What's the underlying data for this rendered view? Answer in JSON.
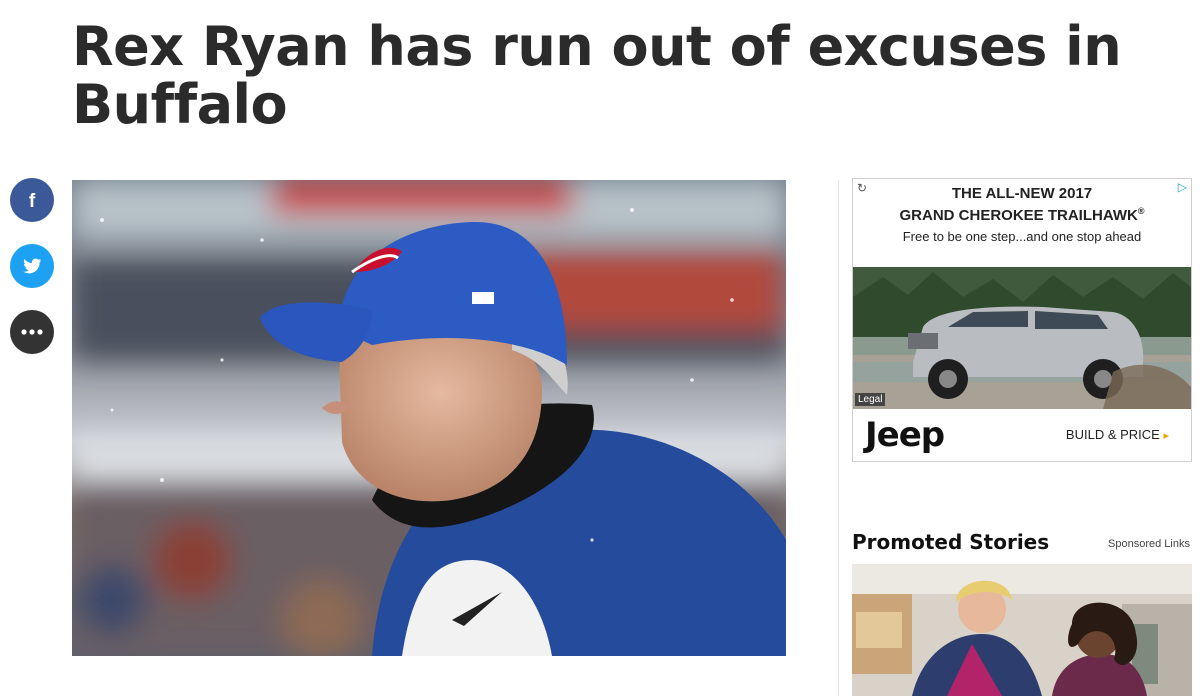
{
  "article": {
    "title": "Rex Ryan has run out of excuses in Buffalo"
  },
  "share": {
    "facebook_icon": "facebook-icon",
    "twitter_icon": "twitter-icon",
    "more_icon": "more-icon"
  },
  "ad": {
    "choices_icon": "adchoices-icon",
    "play_icon": "adplay-icon",
    "headline_line1": "THE ALL-NEW 2017",
    "headline_line2": "GRAND CHEROKEE TRAILHAWK",
    "trademark": "®",
    "tagline": "Free to be one step...and one stop ahead",
    "legal": "Legal",
    "brand": "Jeep",
    "cta": "BUILD & PRICE",
    "cta_arrow": "▸"
  },
  "promoted": {
    "title": "Promoted Stories",
    "sponsored": "Sponsored Links"
  },
  "colors": {
    "facebook": "#3b5998",
    "twitter": "#1da1f2",
    "more": "#333333",
    "cta_arrow": "#f4a300"
  }
}
